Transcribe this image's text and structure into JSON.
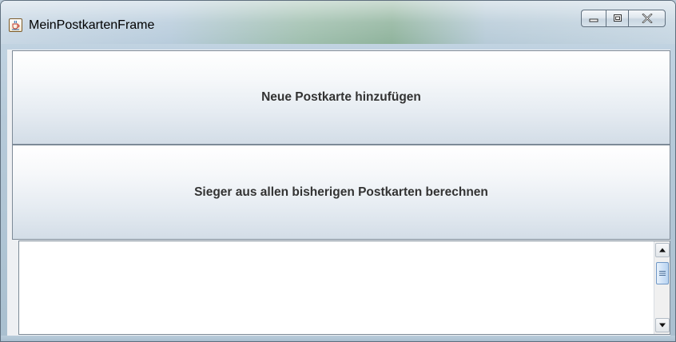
{
  "window": {
    "title": "MeinPostkartenFrame",
    "icon": "java-cup-icon"
  },
  "caption_buttons": {
    "minimize_icon": "minimize-icon",
    "maximize_icon": "maximize-icon",
    "close_icon": "close-icon"
  },
  "buttons": {
    "add_label": "Neue Postkarte hinzufügen",
    "winner_label": "Sieger aus allen bisherigen Postkarten berechnen"
  },
  "output": {
    "value": ""
  },
  "scrollbar": {
    "up_icon": "arrow-up-icon",
    "down_icon": "arrow-down-icon",
    "thumb_icon": "grip-icon"
  }
}
